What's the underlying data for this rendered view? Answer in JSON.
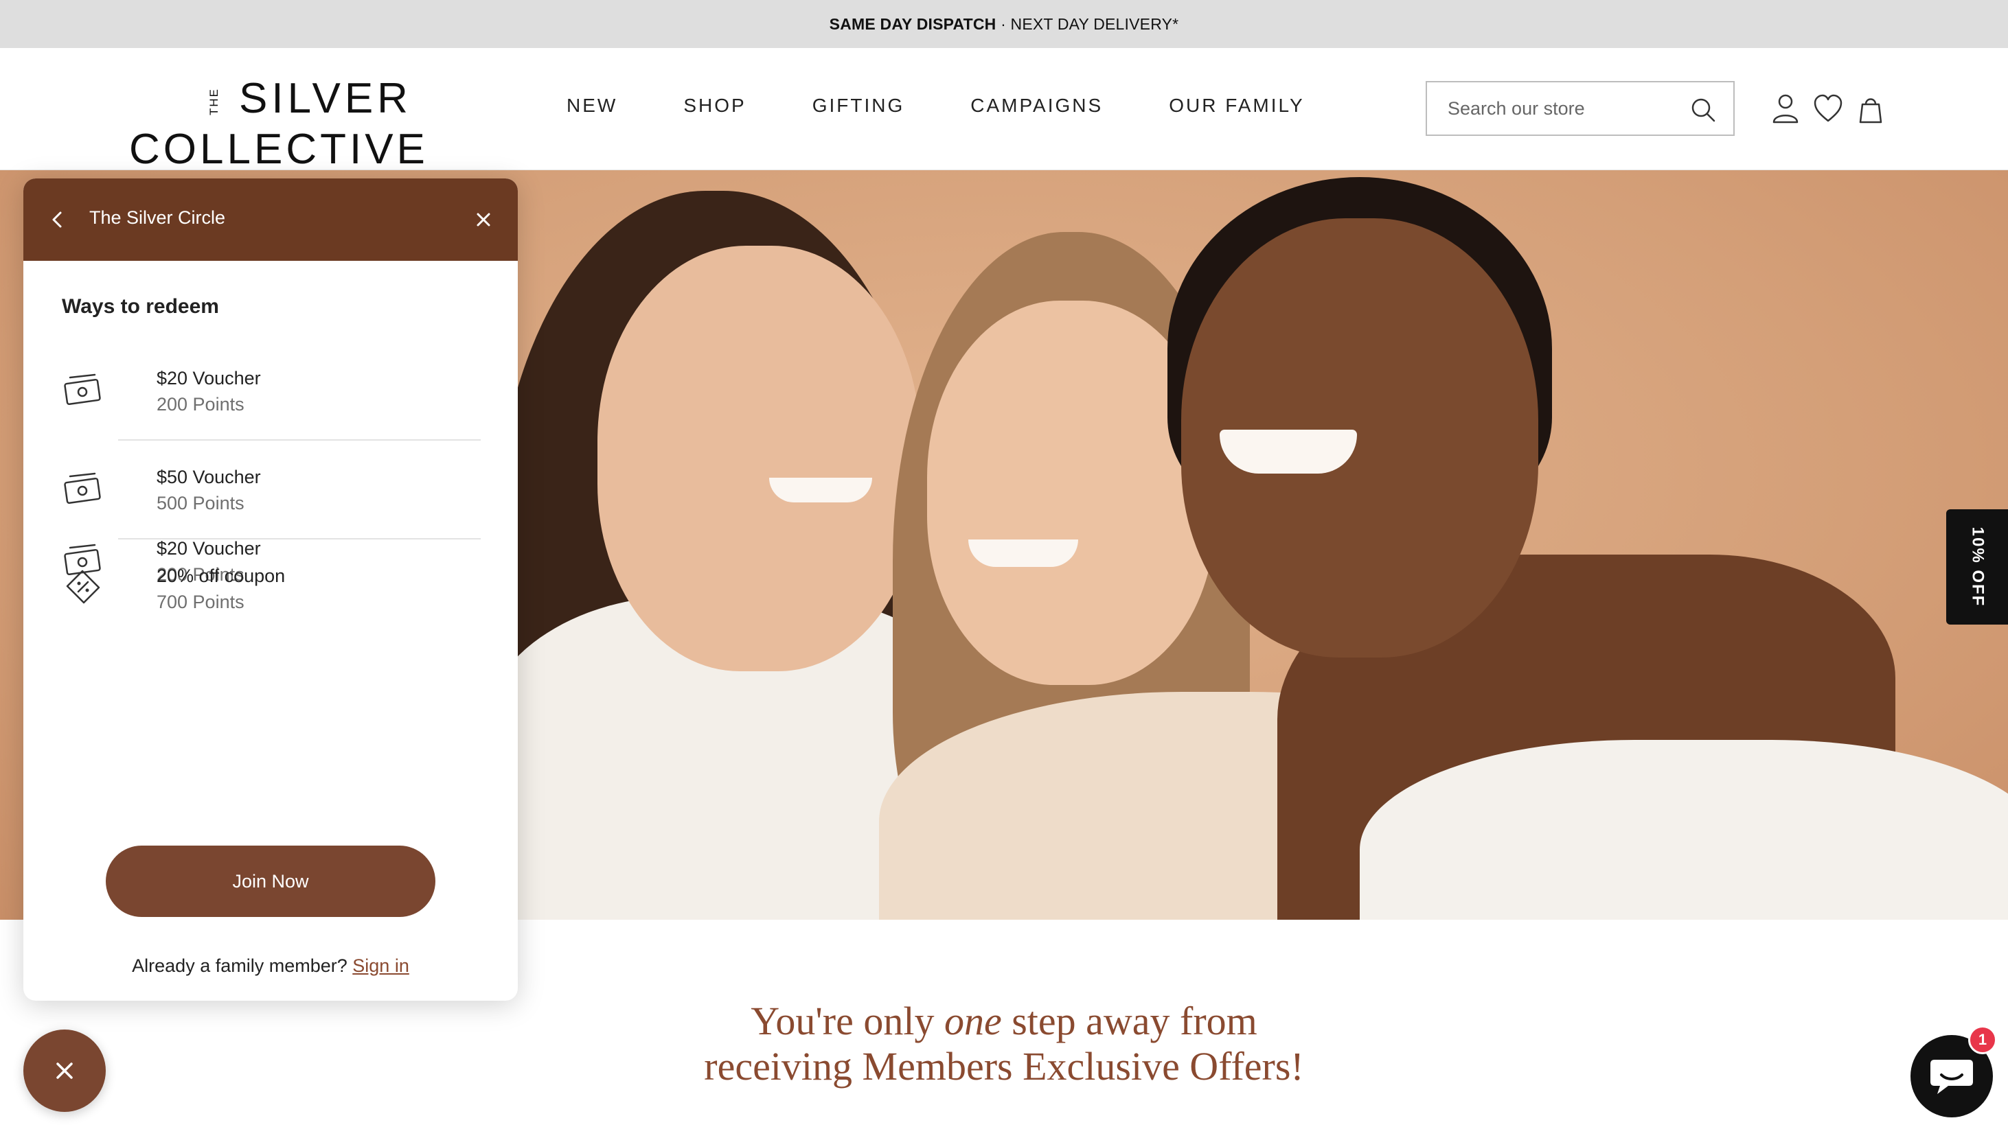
{
  "announcement": {
    "bold": "SAME DAY DISPATCH",
    "separator": " · ",
    "rest": "NEXT DAY DELIVERY*"
  },
  "logo": {
    "the": "THE",
    "line1": "SILVER",
    "line2": "COLLECTIVE"
  },
  "nav": [
    {
      "label": "NEW"
    },
    {
      "label": "SHOP"
    },
    {
      "label": "GIFTING"
    },
    {
      "label": "CAMPAIGNS"
    },
    {
      "label": "OUR FAMILY"
    }
  ],
  "search": {
    "placeholder": "Search our store",
    "icon": "search-icon"
  },
  "header_icons": [
    "account-icon",
    "wishlist-heart-icon",
    "cart-bag-icon"
  ],
  "off_tab": {
    "label": "10% OFF"
  },
  "rewards_panel": {
    "title": "The Silver Circle",
    "section_title": "Ways to redeem",
    "items": [
      {
        "name": "$20 Voucher",
        "points": "200 Points",
        "icon": "cash-voucher-icon"
      },
      {
        "name": "$50 Voucher",
        "points": "500 Points",
        "icon": "cash-voucher-icon"
      },
      {
        "name": "20% off coupon",
        "points": "700 Points",
        "icon": "coupon-ticket-icon"
      }
    ],
    "join_label": "Join Now",
    "signin_prompt": "Already a family member?",
    "signin_link": "Sign in"
  },
  "headline": {
    "pre": "You're only ",
    "em": "one",
    "post1": " step away from",
    "line2": "receiving Members Exclusive Offers!"
  },
  "chat": {
    "badge": "1"
  },
  "colors": {
    "brand_brown": "#6b3a22",
    "button_brown": "#7a4630",
    "headline": "#8a4a30",
    "badge_red": "#e8364a"
  }
}
